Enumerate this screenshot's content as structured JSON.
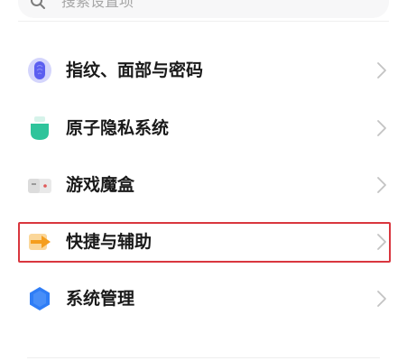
{
  "search": {
    "placeholder": "搜索设置项"
  },
  "items": [
    {
      "label": "指纹、面部与密码",
      "icon": "fingerprint-icon",
      "color": "#5b5ef0"
    },
    {
      "label": "原子隐私系统",
      "icon": "privacy-icon",
      "color": "#2ec49b"
    },
    {
      "label": "游戏魔盒",
      "icon": "game-box-icon",
      "color": "#d8d8d8"
    },
    {
      "label": "快捷与辅助",
      "icon": "shortcut-icon",
      "color": "#f59e1e",
      "highlighted": true
    },
    {
      "label": "系统管理",
      "icon": "system-management-icon",
      "color": "#2f7df6"
    }
  ]
}
